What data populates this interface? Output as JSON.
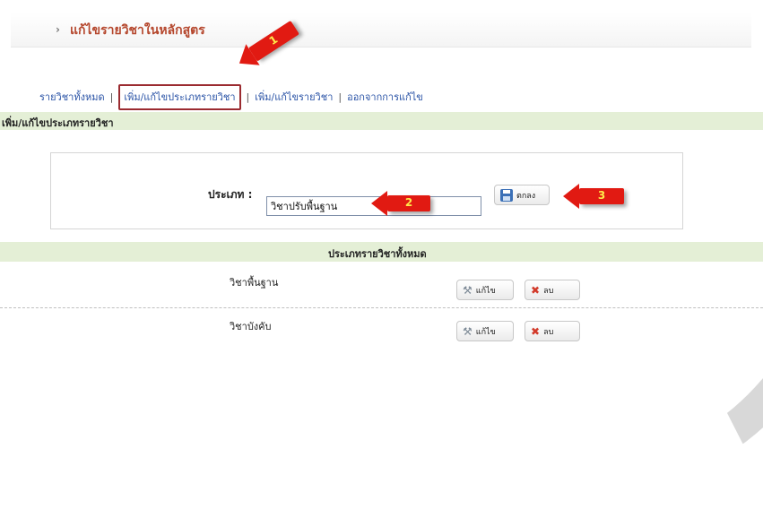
{
  "header": {
    "title": "แก้ไขรายวิชาในหลักสูตร"
  },
  "nav": {
    "items": [
      {
        "label": "รายวิชาทั้งหมด"
      },
      {
        "label": "เพิ่ม/แก้ไขประเภทรายวิชา"
      },
      {
        "label": "เพิ่ม/แก้ไขรายวิชา"
      },
      {
        "label": "ออกจากการแก้ไข"
      }
    ],
    "separator": "|"
  },
  "section": {
    "title": "เพิ่ม/แก้ไขประเภทรายวิชา"
  },
  "form": {
    "type_label": "ประเภท :",
    "type_value": "วิชาปรับพื้นฐาน",
    "ok_label": "ตกลง"
  },
  "list": {
    "header": "ประเภทรายวิชาทั้งหมด",
    "rows": [
      {
        "name": "วิชาพื้นฐาน",
        "edit_label": "แก้ไข",
        "delete_label": "ลบ"
      },
      {
        "name": "วิชาบังคับ",
        "edit_label": "แก้ไข",
        "delete_label": "ลบ"
      }
    ]
  },
  "callouts": [
    "1",
    "2",
    "3"
  ],
  "colors": {
    "accent": "#b5472d",
    "link": "#2a53a6",
    "arrow": "#e11a12",
    "section": "#e4efd6"
  }
}
